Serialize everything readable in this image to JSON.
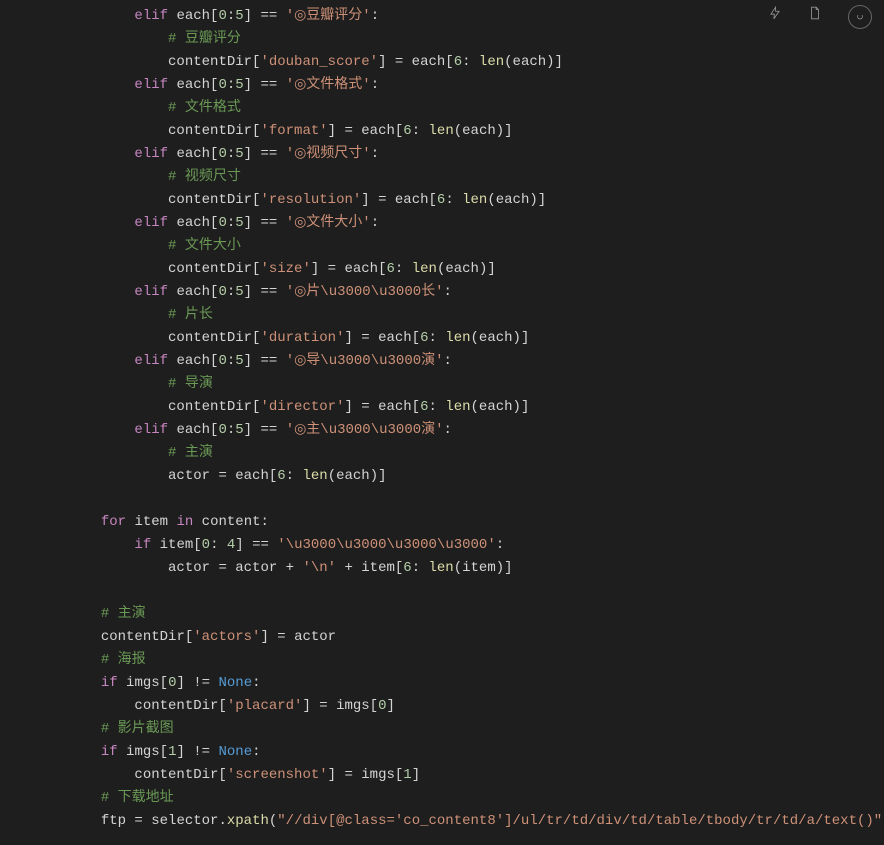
{
  "toolbar": {
    "icons": [
      "lightning-icon",
      "file-icon",
      "circle-icon"
    ]
  },
  "code": {
    "l01": {
      "kw": "elif",
      "cond": "each[",
      "n1": "0",
      "colon": ":",
      "n2": "5",
      "close": "] == ",
      "str": "'◎豆瓣评分'",
      "end": ":"
    },
    "l02": {
      "cmt": "# 豆瓣评分"
    },
    "l03": {
      "pre": "contentDir[",
      "str": "'douban_score'",
      "mid": "] = each[",
      "n1": "6",
      "post": ": ",
      "fn": "len",
      "args": "(each)]"
    },
    "l04": {
      "kw": "elif",
      "cond": "each[",
      "n1": "0",
      "colon": ":",
      "n2": "5",
      "close": "] == ",
      "str": "'◎文件格式'",
      "end": ":"
    },
    "l05": {
      "cmt": "# 文件格式"
    },
    "l06": {
      "pre": "contentDir[",
      "str": "'format'",
      "mid": "] = each[",
      "n1": "6",
      "post": ": ",
      "fn": "len",
      "args": "(each)]"
    },
    "l07": {
      "kw": "elif",
      "cond": "each[",
      "n1": "0",
      "colon": ":",
      "n2": "5",
      "close": "] == ",
      "str": "'◎视频尺寸'",
      "end": ":"
    },
    "l08": {
      "cmt": "# 视频尺寸"
    },
    "l09": {
      "pre": "contentDir[",
      "str": "'resolution'",
      "mid": "] = each[",
      "n1": "6",
      "post": ": ",
      "fn": "len",
      "args": "(each)]"
    },
    "l10": {
      "kw": "elif",
      "cond": "each[",
      "n1": "0",
      "colon": ":",
      "n2": "5",
      "close": "] == ",
      "str": "'◎文件大小'",
      "end": ":"
    },
    "l11": {
      "cmt": "# 文件大小"
    },
    "l12": {
      "pre": "contentDir[",
      "str": "'size'",
      "mid": "] = each[",
      "n1": "6",
      "post": ": ",
      "fn": "len",
      "args": "(each)]"
    },
    "l13": {
      "kw": "elif",
      "cond": "each[",
      "n1": "0",
      "colon": ":",
      "n2": "5",
      "close": "] == ",
      "str": "'◎片\\u3000\\u3000长'",
      "end": ":"
    },
    "l14": {
      "cmt": "# 片长"
    },
    "l15": {
      "pre": "contentDir[",
      "str": "'duration'",
      "mid": "] = each[",
      "n1": "6",
      "post": ": ",
      "fn": "len",
      "args": "(each)]"
    },
    "l16": {
      "kw": "elif",
      "cond": "each[",
      "n1": "0",
      "colon": ":",
      "n2": "5",
      "close": "] == ",
      "str": "'◎导\\u3000\\u3000演'",
      "end": ":"
    },
    "l17": {
      "cmt": "# 导演"
    },
    "l18": {
      "pre": "contentDir[",
      "str": "'director'",
      "mid": "] = each[",
      "n1": "6",
      "post": ": ",
      "fn": "len",
      "args": "(each)]"
    },
    "l19": {
      "kw": "elif",
      "cond": "each[",
      "n1": "0",
      "colon": ":",
      "n2": "5",
      "close": "] == ",
      "str": "'◎主\\u3000\\u3000演'",
      "end": ":"
    },
    "l20": {
      "cmt": "# 主演"
    },
    "l21": {
      "pre": "actor = each[",
      "n1": "6",
      "post": ": ",
      "fn": "len",
      "args": "(each)]"
    },
    "l22": {
      "kw1": "for",
      "v1": " item ",
      "kw2": "in",
      "v2": " content:"
    },
    "l23": {
      "kw": "if",
      "v": " item[",
      "n1": "0",
      "colon": ": ",
      "n2": "4",
      "close": "] == ",
      "str": "'\\u3000\\u3000\\u3000\\u3000'",
      "end": ":"
    },
    "l24": {
      "pre": "actor = actor + ",
      "str1": "'\\n'",
      "mid": " + item[",
      "n1": "6",
      "post": ": ",
      "fn": "len",
      "args": "(item)]"
    },
    "l25": {
      "cmt": "# 主演"
    },
    "l26": {
      "pre": "contentDir[",
      "str": "'actors'",
      "post": "] = actor"
    },
    "l27": {
      "cmt": "# 海报"
    },
    "l28": {
      "kw": "if",
      "v": " imgs[",
      "n": "0",
      "close": "] != ",
      "none": "None",
      "end": ":"
    },
    "l29": {
      "pre": "contentDir[",
      "str": "'placard'",
      "mid": "] = imgs[",
      "n": "0",
      "post": "]"
    },
    "l30": {
      "cmt": "# 影片截图"
    },
    "l31": {
      "kw": "if",
      "v": " imgs[",
      "n": "1",
      "close": "] != ",
      "none": "None",
      "end": ":"
    },
    "l32": {
      "pre": "contentDir[",
      "str": "'screenshot'",
      "mid": "] = imgs[",
      "n": "1",
      "post": "]"
    },
    "l33": {
      "cmt": "# 下载地址"
    },
    "l34": {
      "pre": "ftp = selector.",
      "fn": "xpath",
      "open": "(",
      "str": "\"//div[@class='co_content8']/ul/tr/td/div/td/table/tbody/tr/td/a/text()\"",
      "close": ")"
    }
  }
}
